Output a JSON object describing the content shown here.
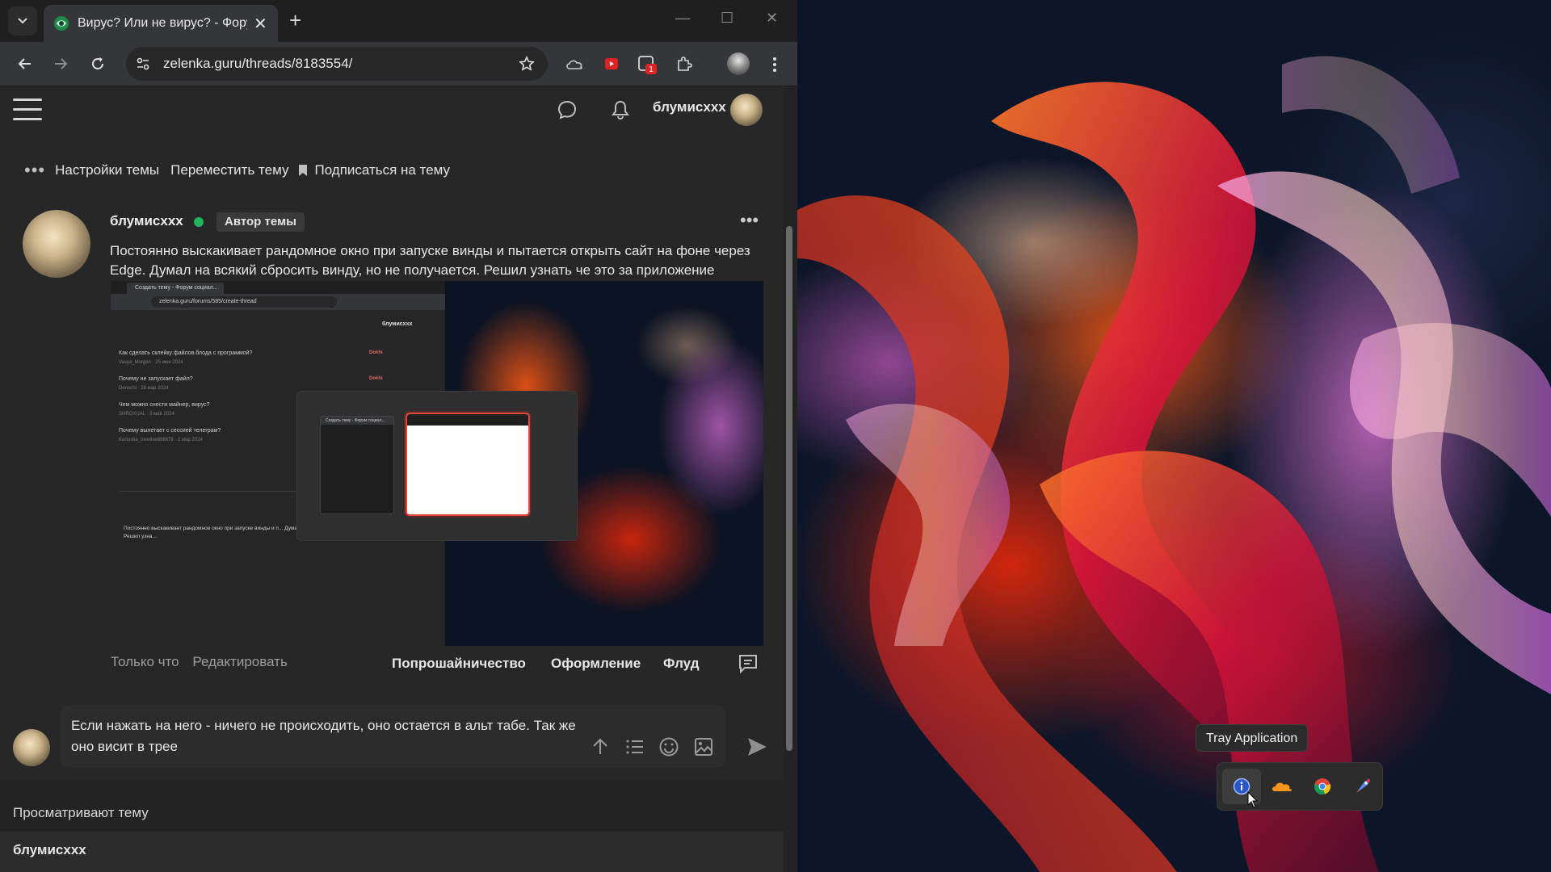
{
  "browser": {
    "tab_title": "Вирус? Или не вирус? - Форум",
    "url": "zelenka.guru/threads/8183554/"
  },
  "site": {
    "username": "блумисxxx"
  },
  "thread_actions": [
    "Настройки темы",
    "Переместить тему",
    "Подписаться на тему"
  ],
  "post": {
    "author": "блумисxxx",
    "author_badge": "Автор темы",
    "text": "Постоянно выскакивает рандомное окно при запуске винды и пытается открыть сайт на фоне через Edge. Думал на всякий сбросить винду, но не получается. Решил узнать че это за приложение",
    "time": "Только что",
    "edit": "Редактировать",
    "tags": [
      "Попрошайничество",
      "Оформление",
      "Флуд"
    ]
  },
  "embedded_screenshot": {
    "tab": "Создать тему - Форум социал...",
    "url": "zelenka.guru/forums/585/create-thread",
    "user": "блумисxxx",
    "rows": [
      {
        "title": "Как сделать склейку файлов.блода с программой?",
        "sub": "Vasya_Morgan · 25 июн 2024",
        "name": "Dokhi"
      },
      {
        "title": "Почему не запускает файл?",
        "sub": "Denochi · 28 мар 2024",
        "name": "Dokhi"
      },
      {
        "title": "Чем можно снести майнер, вирус?",
        "sub": "SHROXUAL · 3 май 2024",
        "name": ""
      },
      {
        "title": "Почему вылетает с сессией телеграм?",
        "sub": "Kartoxka_Invetive888679 · 2 мар 2024",
        "name": ""
      }
    ],
    "editor_text": "Постоянно выскакивает рандомное окно при запуске винды и п... Думал на всякий сбросить винду, но не получается. Решил узна..."
  },
  "reply": {
    "text": "Если нажать на него - ничего не происходить, оно остается в альт табе. Так же оно висит в трее"
  },
  "viewers": {
    "title": "Просматривают тему",
    "names": [
      "блумисxxx"
    ]
  },
  "desktop": {
    "tooltip": "Tray Application"
  }
}
